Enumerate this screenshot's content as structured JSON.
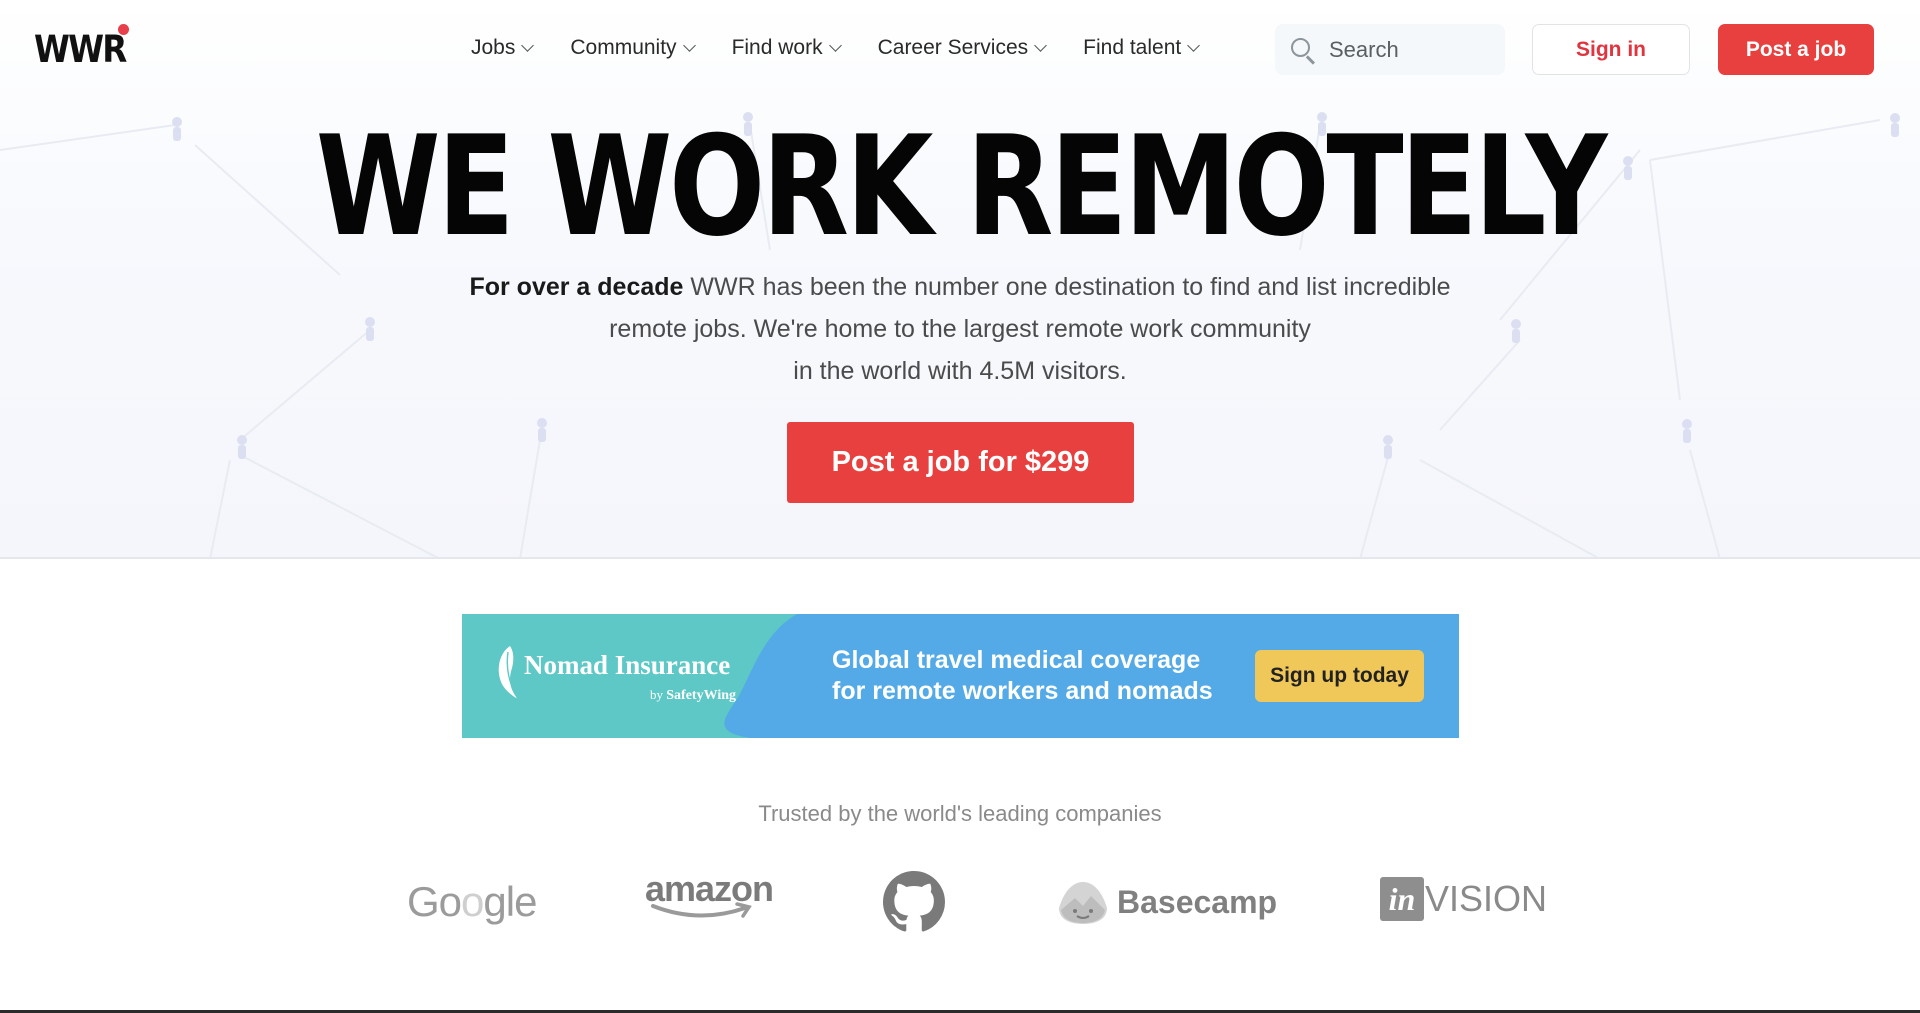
{
  "brand": {
    "logo_text": "WWR",
    "accent_color": "#e8403f"
  },
  "nav": {
    "items": [
      {
        "label": "Jobs"
      },
      {
        "label": "Community"
      },
      {
        "label": "Find work"
      },
      {
        "label": "Career Services"
      },
      {
        "label": "Find talent"
      }
    ],
    "search_placeholder": "Search",
    "signin_label": "Sign in",
    "post_job_label": "Post a job"
  },
  "hero": {
    "title": "WE WORK REMOTELY",
    "desc_bold": "For over a decade",
    "desc_line1": " WWR has been the number one destination to find and list incredible",
    "desc_line2": "remote jobs. We're home to the largest remote work community",
    "desc_line3": "in the world with 4.5M visitors.",
    "cta_label": "Post a job for $299"
  },
  "ad": {
    "brand": "Nomad Insurance",
    "by_prefix": "by",
    "by_brand": "SafetyWing",
    "line1": "Global travel medical coverage",
    "line2": "for remote workers and nomads",
    "button_label": "Sign up today",
    "colors": {
      "teal": "#5ec8c6",
      "blue": "#53aae6",
      "button": "#f0c85a"
    }
  },
  "trusted": {
    "heading": "Trusted by the world's leading companies",
    "companies": [
      {
        "name": "Google",
        "icon": "google-logo"
      },
      {
        "name": "amazon",
        "icon": "amazon-logo"
      },
      {
        "name": "GitHub",
        "icon": "github-logo"
      },
      {
        "name": "Basecamp",
        "icon": "basecamp-logo"
      },
      {
        "name": "invision",
        "icon": "invision-logo",
        "box_text": "in",
        "rest_text": "VISION"
      }
    ]
  }
}
